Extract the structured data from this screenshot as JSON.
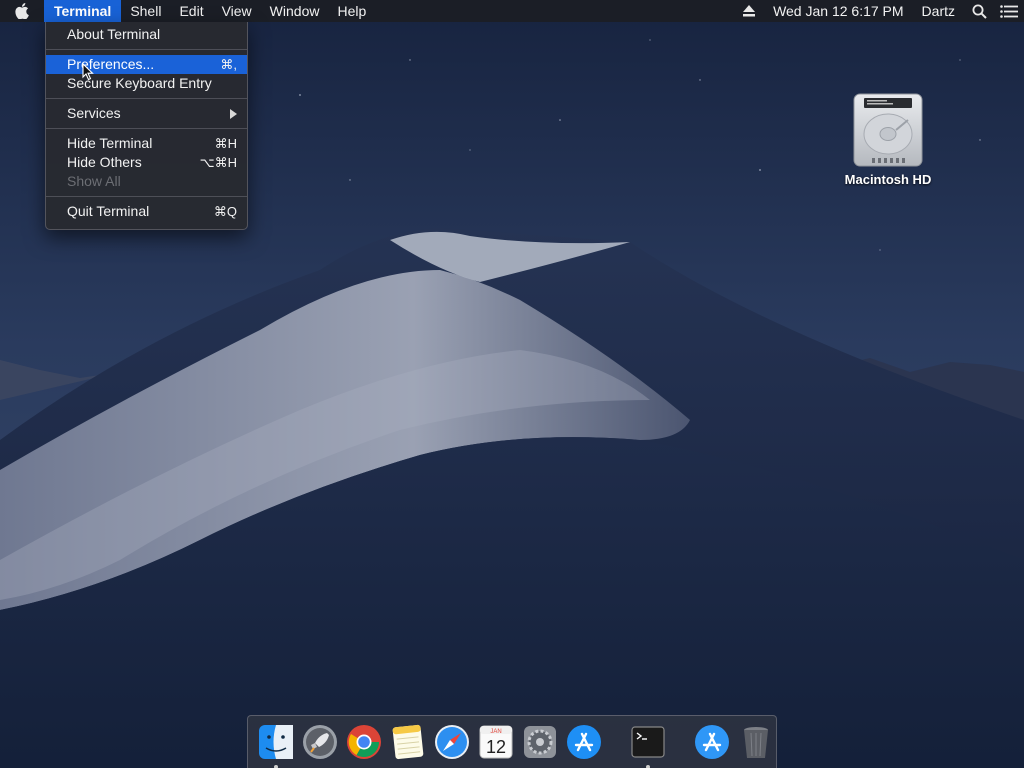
{
  "menubar": {
    "app_name": "Terminal",
    "menus": [
      "Shell",
      "Edit",
      "View",
      "Window",
      "Help"
    ],
    "clock": "Wed Jan 12  6:17 PM",
    "user": "Dartz"
  },
  "app_menu": {
    "items": [
      {
        "label": "About Terminal",
        "shortcut": ""
      },
      {
        "label": "Preferences...",
        "shortcut": "⌘,"
      },
      {
        "label": "Secure Keyboard Entry",
        "shortcut": ""
      },
      {
        "label": "Services",
        "shortcut": ""
      },
      {
        "label": "Hide Terminal",
        "shortcut": "⌘H"
      },
      {
        "label": "Hide Others",
        "shortcut": "⌥⌘H"
      },
      {
        "label": "Show All",
        "shortcut": ""
      },
      {
        "label": "Quit Terminal",
        "shortcut": "⌘Q"
      }
    ],
    "highlighted": "Preferences...",
    "disabled": [
      "Show All"
    ]
  },
  "desktop": {
    "disk_label": "Macintosh HD"
  },
  "dock": {
    "calendar_month": "JAN",
    "calendar_day": "12",
    "running_apps": [
      "Finder",
      "Terminal"
    ]
  },
  "colors": {
    "menu_highlight": "#1a62d8",
    "menubar_bg": "#1c1e24",
    "sky": "#1b2a4a"
  }
}
